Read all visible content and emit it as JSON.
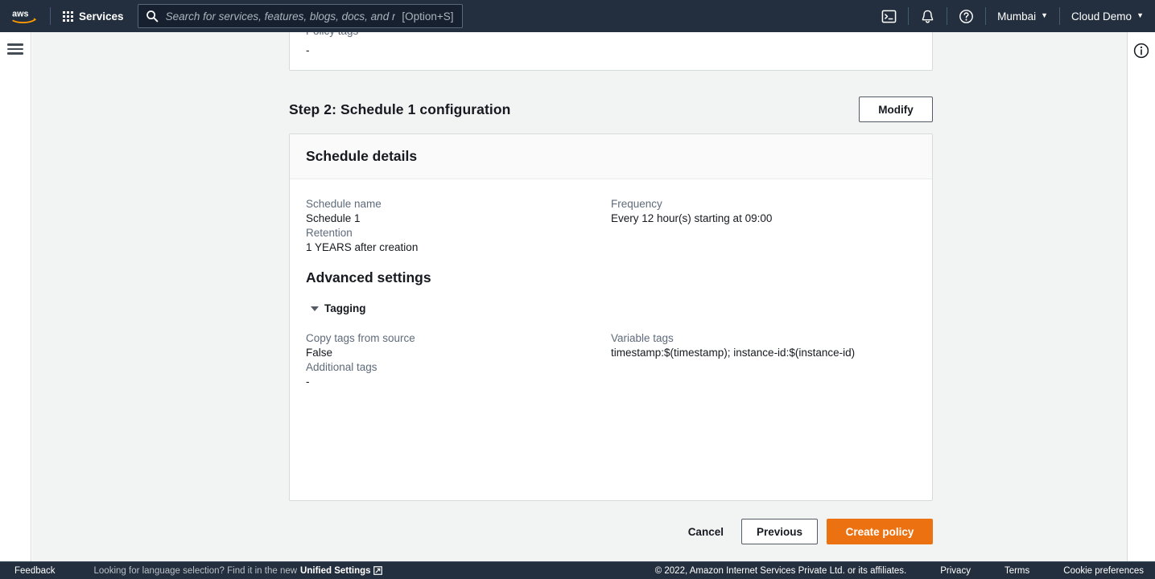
{
  "top_nav": {
    "logo_name": "aws-logo",
    "services_label": "Services",
    "search": {
      "placeholder": "Search for services, features, blogs, docs, and more",
      "value": "",
      "shortcut": "[Option+S]"
    },
    "cloudshell_name": "cloudshell-icon",
    "notifications_name": "bell-icon",
    "help_name": "help-circle-icon",
    "region_label": "Mumbai",
    "account_label": "Cloud Demo",
    "caret": "▼",
    "bg_color": "#232f3e"
  },
  "left_nav": {
    "hamburger_name": "hamburger-menu-icon"
  },
  "right_panel": {
    "info_name": "info-circle-icon"
  },
  "previous_card": {
    "policy_tags_label": "Policy tags",
    "policy_tags_value": "-"
  },
  "step": {
    "title": "Step 2: Schedule 1 configuration",
    "modify_label": "Modify"
  },
  "card": {
    "header_title": "Schedule details",
    "fields": {
      "schedule_name_label": "Schedule name",
      "schedule_name_value": "Schedule 1",
      "frequency_label": "Frequency",
      "frequency_value": "Every 12 hour(s) starting at 09:00",
      "retention_label": "Retention",
      "retention_value": "1 YEARS after creation"
    },
    "advanced_heading": "Advanced settings",
    "tagging_label": "Tagging",
    "tagging_expanded": true,
    "tagging": {
      "copy_tags_label": "Copy tags from source",
      "copy_tags_value": "False",
      "variable_tags_label": "Variable tags",
      "variable_tags_value": "timestamp:$(timestamp); instance-id:$(instance-id)",
      "additional_tags_label": "Additional tags",
      "additional_tags_value": "-"
    }
  },
  "actions": {
    "cancel_label": "Cancel",
    "previous_label": "Previous",
    "create_label": "Create policy",
    "primary_color": "#ec7211"
  },
  "footer": {
    "feedback_label": "Feedback",
    "language_note": "Looking for language selection? Find it in the new",
    "unified_settings_label": "Unified Settings",
    "external_icon_name": "external-link-icon",
    "copyright": "© 2022, Amazon Internet Services Private Ltd. or its affiliates.",
    "privacy_label": "Privacy",
    "terms_label": "Terms",
    "cookie_label": "Cookie preferences"
  }
}
